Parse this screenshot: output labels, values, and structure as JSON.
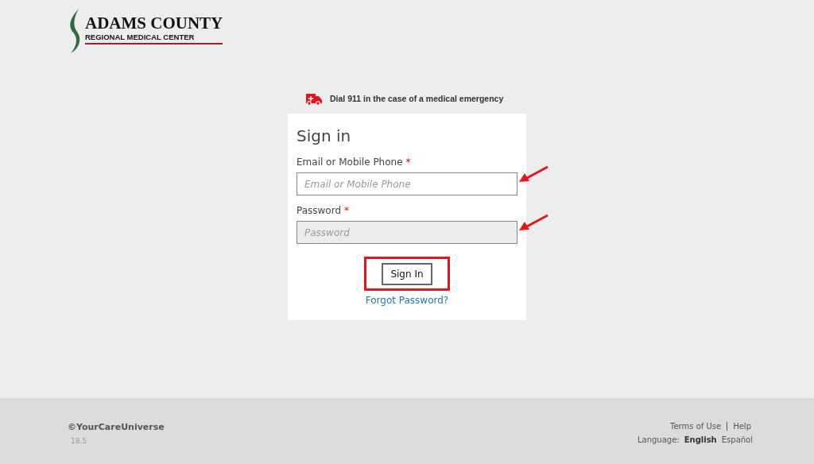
{
  "logo": {
    "title": "ADAMS COUNTY",
    "subtitle": "REGIONAL MEDICAL CENTER"
  },
  "alert": {
    "text": "Dial 911 in the case of a medical emergency"
  },
  "form": {
    "title": "Sign in",
    "fields": [
      {
        "label": "Email or Mobile Phone",
        "required_mark": "*",
        "placeholder": "Email or Mobile Phone",
        "disabled": false,
        "annotated": true
      },
      {
        "label": "Password",
        "required_mark": "*",
        "placeholder": "Password",
        "disabled": true,
        "annotated": true
      }
    ],
    "submit": {
      "label": "Sign In",
      "annotated": true
    },
    "link": "Forgot Password?"
  },
  "footer": {
    "copyright": "©YourCareUniverse",
    "version": "18.5",
    "links": [
      "Terms of Use",
      "Help"
    ],
    "language_label": "Language:",
    "languages": [
      {
        "label": "English",
        "selected": true
      },
      {
        "label": "Español",
        "selected": false
      }
    ]
  }
}
